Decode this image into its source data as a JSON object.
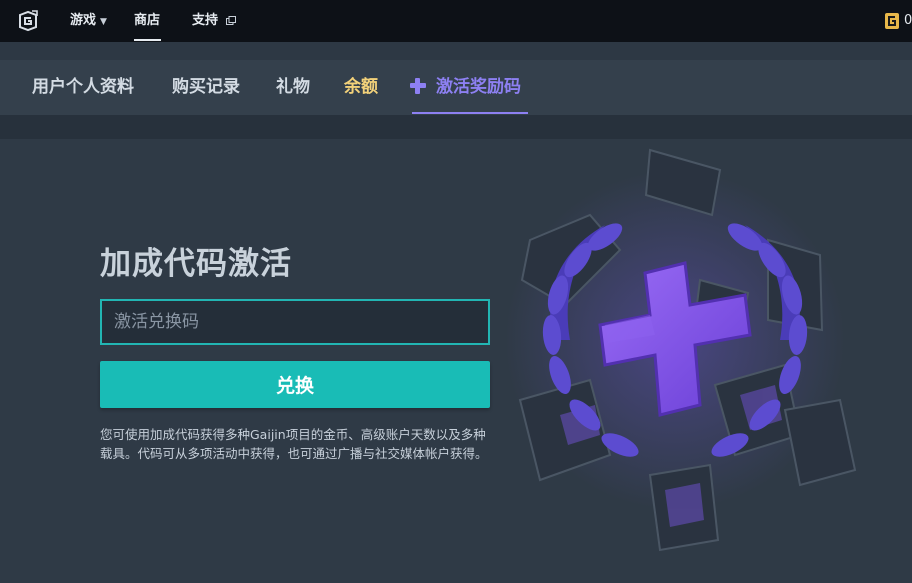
{
  "topbar": {
    "games_label": "游戏",
    "store_label": "商店",
    "support_label": "支持",
    "gold_balance": "0"
  },
  "subnav": {
    "profile": "用户个人资料",
    "orders": "购买记录",
    "gifts": "礼物",
    "balance": "余额",
    "redeem": "激活奖励码",
    "active_tab": "redeem"
  },
  "redeem": {
    "title": "加成代码激活",
    "input_placeholder": "激活兑换码",
    "input_value": "",
    "button_label": "兑换",
    "description": "您可使用加成代码获得多种Gaijin项目的金币、高级账户天数以及多种载具。代码可从多项活动中获得，也可通过广播与社交媒体帐户获得。"
  },
  "colors": {
    "accent_teal": "#19bcb6",
    "accent_purple": "#8d80f2",
    "balance_gold": "#f3d27a",
    "background": "#2f3a46"
  },
  "icons": [
    "gaijin-logo-icon",
    "chevron-down-icon",
    "external-link-icon",
    "gold-coin-icon",
    "plus-icon"
  ]
}
